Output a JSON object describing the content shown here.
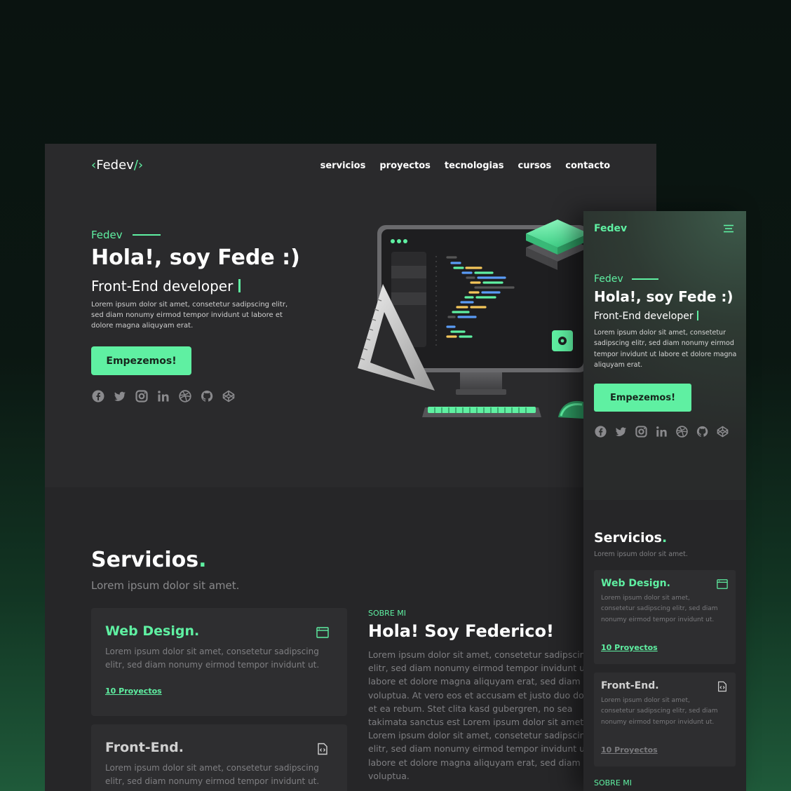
{
  "desktop": {
    "logo": {
      "open": "‹",
      "name": "Fedev",
      "close": "/›"
    },
    "nav": [
      "servicios",
      "proyectos",
      "tecnologias",
      "cursos",
      "contacto"
    ],
    "hero": {
      "eyebrow": "Fedev",
      "title": "Hola!, soy Fede :)",
      "subtitle": "Front-End developer",
      "description": "Lorem ipsum dolor sit amet, consetetur sadipscing elitr, sed diam nonumy eirmod tempor invidunt ut labore et dolore magna aliquyam erat.",
      "cta": "Empezemos!"
    },
    "socials": [
      "facebook-icon",
      "twitter-icon",
      "instagram-icon",
      "linkedin-icon",
      "dribbble-icon",
      "github-icon",
      "codepen-icon"
    ],
    "servicios": {
      "title": "Servicios",
      "subtitle": "Lorem ipsum dolor sit amet.",
      "cards": [
        {
          "title": "Web Design.",
          "icon": "browser-window-icon",
          "description": "Lorem ipsum dolor sit amet, consetetur sadipscing elitr, sed diam nonumy eirmod tempor invidunt ut.",
          "link": "10 Proyectos"
        },
        {
          "title": "Front-End.",
          "icon": "code-file-icon",
          "description": "Lorem ipsum dolor sit amet, consetetur sadipscing elitr, sed diam nonumy eirmod tempor invidunt ut."
        }
      ]
    },
    "about": {
      "eyebrow": "SOBRE MI",
      "title": "Hola! Soy Federico!",
      "lines": [
        "Lorem ipsum dolor sit amet, consetetur sadipscing",
        "elitr, sed diam nonumy eirmod tempor invidunt ut",
        "labore et dolore magna aliquyam erat, sed diam",
        "voluptua. At vero eos et accusam et justo duo dolores",
        "et ea rebum. Stet clita kasd gubergren, no sea",
        "takimata sanctus est Lorem ipsum dolor sit amet.",
        "Lorem ipsum dolor sit amet, consetetur sadipscing",
        "elitr, sed diam nonumy eirmod tempor invidunt ut",
        "labore et dolore magna aliquyam erat, sed diam",
        "voluptua."
      ]
    }
  },
  "mobile": {
    "logo": "Fedev",
    "hero": {
      "eyebrow": "Fedev",
      "title": "Hola!, soy Fede :)",
      "subtitle": "Front-End developer",
      "description": "Lorem ipsum dolor sit amet, consetetur sadipscing elitr, sed diam nonumy eirmod tempor invidunt ut labore et dolore magna aliquyam erat.",
      "cta": "Empezemos!"
    },
    "servicios": {
      "title": "Servicios",
      "subtitle": "Lorem ipsum dolor sit amet.",
      "cards": [
        {
          "title": "Web Design.",
          "description": "Lorem ipsum dolor sit amet, consetetur sadipscing elitr, sed diam nonumy eirmod tempor invidunt ut.",
          "link": "10 Proyectos"
        },
        {
          "title": "Front-End.",
          "description": "Lorem ipsum dolor sit amet, consetetur sadipscing elitr, sed diam nonumy eirmod tempor invidunt ut.",
          "link": "10 Proyectos"
        }
      ]
    },
    "about_eyebrow": "SOBRE MI"
  },
  "colors": {
    "accent": "#5ff0a2",
    "surface": "#262628",
    "card": "#2e2e30",
    "muted": "#7f7f82"
  }
}
